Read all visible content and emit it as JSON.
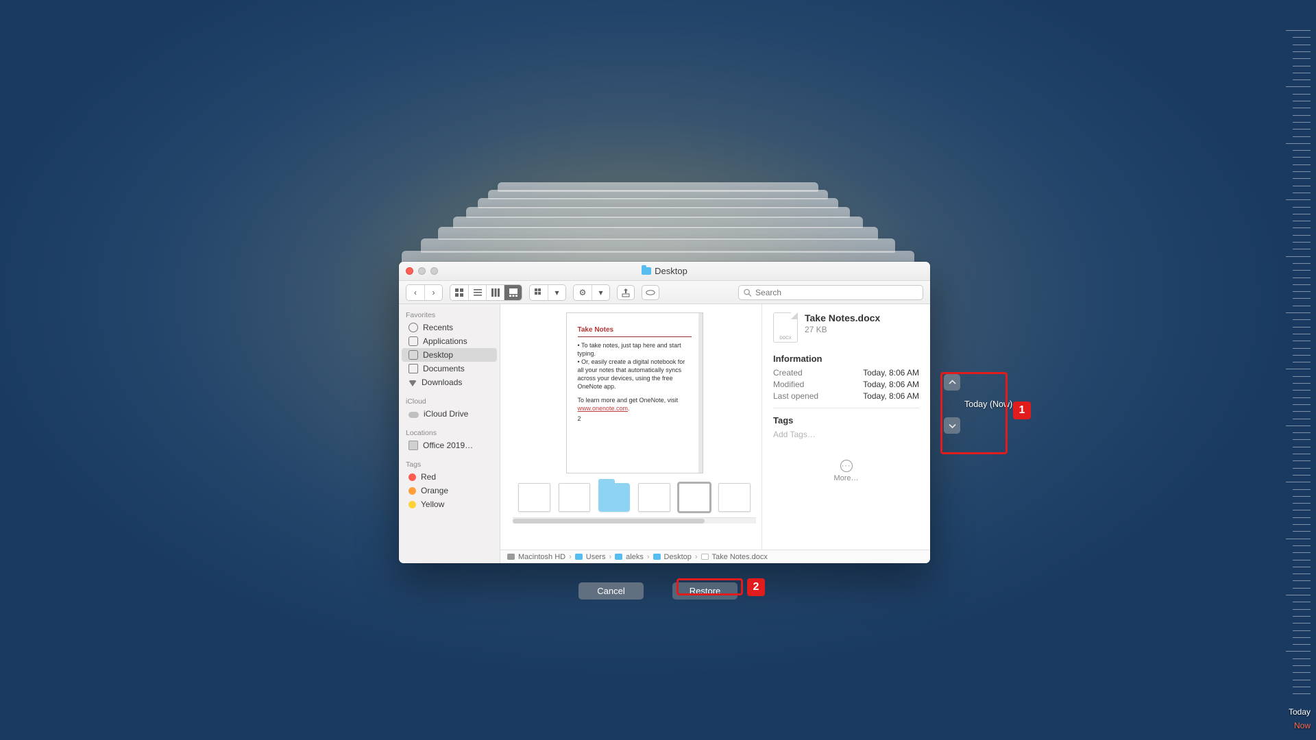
{
  "window": {
    "title": "Desktop"
  },
  "search": {
    "placeholder": "Search"
  },
  "sidebar": {
    "sections": [
      {
        "header": "Favorites",
        "items": [
          {
            "label": "Recents"
          },
          {
            "label": "Applications"
          },
          {
            "label": "Desktop",
            "selected": true
          },
          {
            "label": "Documents"
          },
          {
            "label": "Downloads"
          }
        ]
      },
      {
        "header": "iCloud",
        "items": [
          {
            "label": "iCloud Drive"
          }
        ]
      },
      {
        "header": "Locations",
        "items": [
          {
            "label": "Office 2019…"
          }
        ]
      },
      {
        "header": "Tags",
        "items": [
          {
            "label": "Red",
            "color": "#ff5c51"
          },
          {
            "label": "Orange",
            "color": "#ff9f3a"
          },
          {
            "label": "Yellow",
            "color": "#ffd23a"
          }
        ]
      }
    ]
  },
  "preview": {
    "heading": "Take Notes",
    "bullets": [
      "To take notes, just tap here and start typing.",
      "Or, easily create a digital notebook for all your notes that automatically syncs across your devices, using the free OneNote app."
    ],
    "footer_pre": "To learn more and get OneNote, visit ",
    "footer_link": "www.onenote.com",
    "footer_post": ".",
    "pagenum": "2"
  },
  "file": {
    "name": "Take Notes.docx",
    "ext_label": "DOCX",
    "size": "27 KB",
    "info_header": "Information",
    "created_label": "Created",
    "created_value": "Today, 8:06 AM",
    "modified_label": "Modified",
    "modified_value": "Today, 8:06 AM",
    "opened_label": "Last opened",
    "opened_value": "Today, 8:06 AM",
    "tags_header": "Tags",
    "tags_placeholder": "Add Tags…",
    "more_label": "More…"
  },
  "pathbar": [
    "Macintosh HD",
    "Users",
    "aleks",
    "Desktop",
    "Take Notes.docx"
  ],
  "bottom": {
    "cancel": "Cancel",
    "restore": "Restore"
  },
  "timeline": {
    "label": "Today (Now)",
    "right_today": "Today",
    "right_now": "Now"
  },
  "annotations": {
    "one": "1",
    "two": "2"
  }
}
